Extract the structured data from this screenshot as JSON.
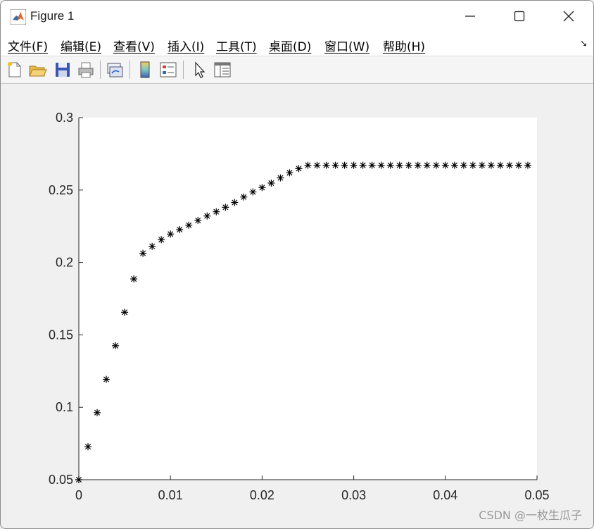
{
  "window": {
    "title": "Figure 1",
    "controls": {
      "minimize": "minimize",
      "maximize": "maximize",
      "close": "close"
    }
  },
  "menu": {
    "items": [
      "文件(F)",
      "编辑(E)",
      "查看(V)",
      "插入(I)",
      "工具(T)",
      "桌面(D)",
      "窗口(W)",
      "帮助(H)"
    ],
    "overflow_icon": "dock-arrow-icon"
  },
  "toolbar": {
    "buttons": [
      "new-figure-icon",
      "open-file-icon",
      "save-icon",
      "print-icon",
      "link-plot-icon",
      "colorbar-icon",
      "legend-icon",
      "edit-plot-icon",
      "property-inspector-icon"
    ]
  },
  "watermark": "CSDN @一枚生瓜子",
  "chart_data": {
    "type": "scatter",
    "marker": "*",
    "marker_color": "#000000",
    "xlim": [
      0,
      0.05
    ],
    "ylim": [
      0.05,
      0.3
    ],
    "xticks": [
      "0",
      "0.01",
      "0.02",
      "0.03",
      "0.04",
      "0.05"
    ],
    "yticks": [
      "0.05",
      "0.1",
      "0.15",
      "0.2",
      "0.25",
      "0.3"
    ],
    "grid": false,
    "x": [
      0,
      0.001,
      0.002,
      0.003,
      0.004,
      0.005,
      0.006,
      0.007,
      0.008,
      0.009,
      0.01,
      0.011,
      0.012,
      0.013,
      0.014,
      0.015,
      0.016,
      0.017,
      0.018,
      0.019,
      0.02,
      0.021,
      0.022,
      0.023,
      0.024,
      0.025,
      0.026,
      0.027,
      0.028,
      0.029,
      0.03,
      0.031,
      0.032,
      0.033,
      0.034,
      0.035,
      0.036,
      0.037,
      0.038,
      0.039,
      0.04,
      0.041,
      0.042,
      0.043,
      0.044,
      0.045,
      0.046,
      0.047,
      0.048,
      0.049
    ],
    "y": [
      0.05,
      0.0728,
      0.0963,
      0.1193,
      0.1425,
      0.1656,
      0.1886,
      0.2063,
      0.2111,
      0.2157,
      0.2196,
      0.2227,
      0.2257,
      0.229,
      0.2321,
      0.235,
      0.2381,
      0.2414,
      0.2452,
      0.2487,
      0.2517,
      0.2548,
      0.2584,
      0.2619,
      0.2648,
      0.2671,
      0.2671,
      0.2671,
      0.2671,
      0.2671,
      0.2671,
      0.2671,
      0.2671,
      0.2671,
      0.2671,
      0.2671,
      0.2671,
      0.2671,
      0.2671,
      0.2671,
      0.2671,
      0.2671,
      0.2671,
      0.2671,
      0.2671,
      0.2671,
      0.2671,
      0.2671,
      0.2671,
      0.2671
    ]
  }
}
